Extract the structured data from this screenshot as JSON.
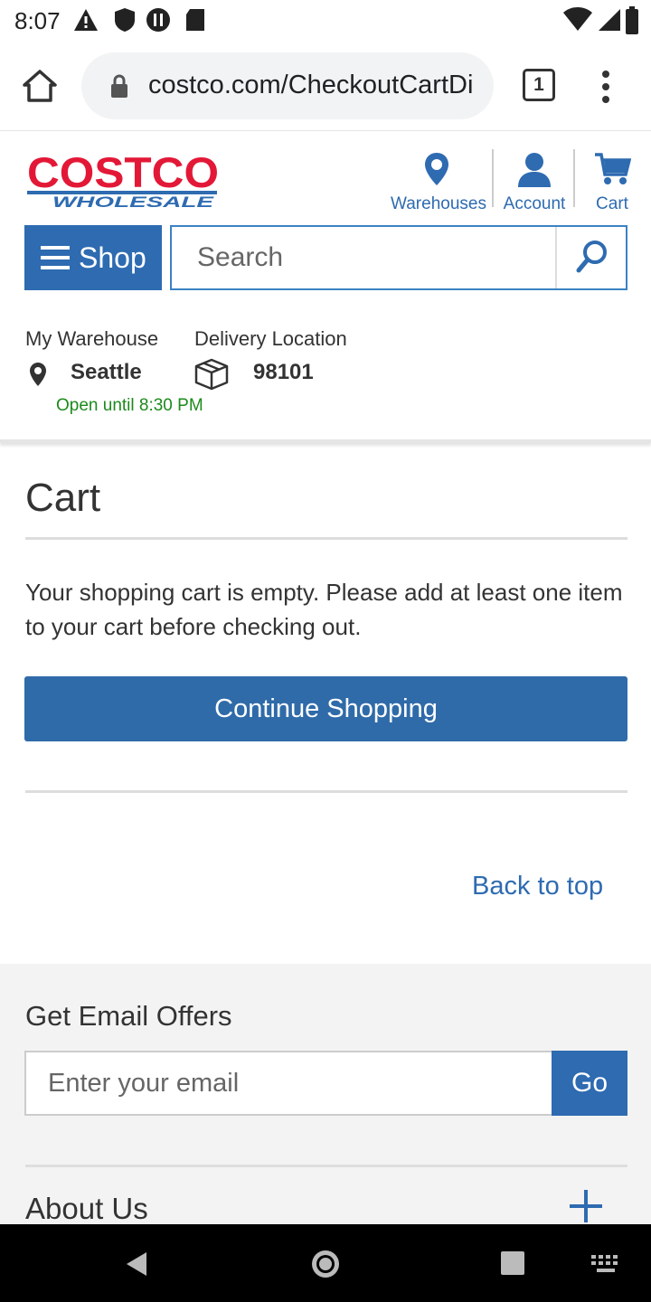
{
  "status_bar": {
    "time": "8:07"
  },
  "browser": {
    "url": "costco.com/CheckoutCartDi",
    "tab_count": "1"
  },
  "header": {
    "warehouses_label": "Warehouses",
    "account_label": "Account",
    "cart_label": "Cart",
    "shop_label": "Shop",
    "search_placeholder": "Search"
  },
  "location": {
    "warehouse_label": "My Warehouse",
    "warehouse_value": "Seattle",
    "open_status": "Open until 8:30 PM",
    "delivery_label": "Delivery Location",
    "delivery_value": "98101"
  },
  "cart": {
    "title": "Cart",
    "empty_message": "Your shopping cart is empty. Please add at least one item to your cart before checking out.",
    "continue_label": "Continue Shopping",
    "back_to_top": "Back to top"
  },
  "footer": {
    "offers_title": "Get Email Offers",
    "email_placeholder": "Enter your email",
    "go_label": "Go",
    "about_label": "About Us"
  },
  "colors": {
    "brand_blue": "#2e6bb1",
    "brand_red": "#e31837",
    "open_green": "#1c8a1c"
  }
}
